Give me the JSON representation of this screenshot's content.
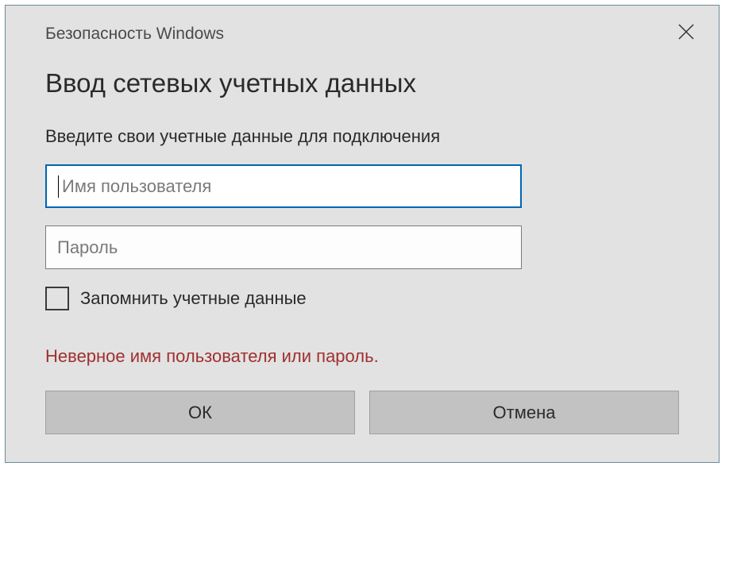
{
  "titlebar": {
    "title": "Безопасность Windows"
  },
  "dialog": {
    "heading": "Ввод сетевых учетных данных",
    "prompt": "Введите свои учетные данные для подключения",
    "username_placeholder": "Имя пользователя",
    "username_value": "",
    "password_placeholder": "Пароль",
    "password_value": "",
    "remember_label": "Запомнить учетные данные",
    "remember_checked": false,
    "error": "Неверное имя пользователя или пароль.",
    "ok_label": "ОК",
    "cancel_label": "Отмена"
  }
}
